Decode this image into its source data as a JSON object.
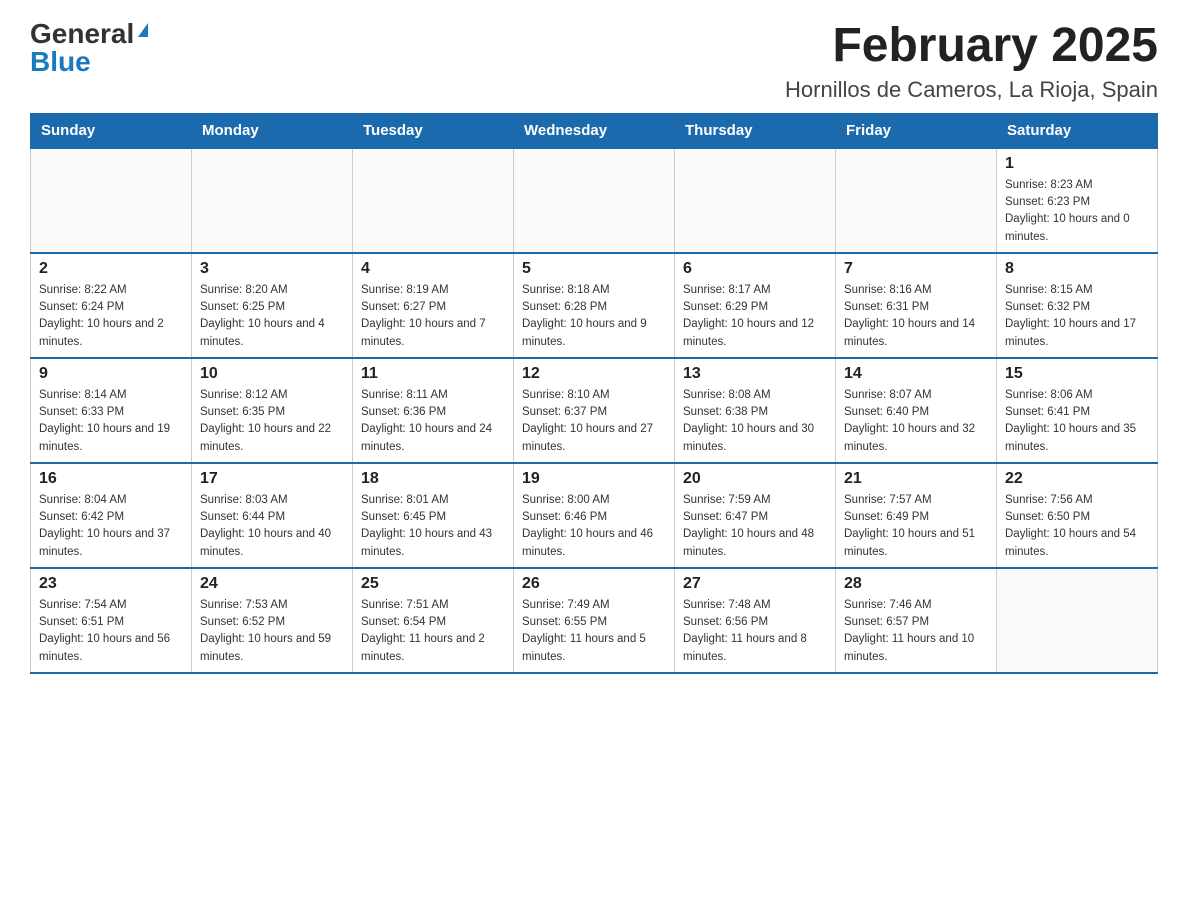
{
  "logo": {
    "general": "General",
    "blue": "Blue"
  },
  "title": {
    "month": "February 2025",
    "location": "Hornillos de Cameros, La Rioja, Spain"
  },
  "weekdays": [
    "Sunday",
    "Monday",
    "Tuesday",
    "Wednesday",
    "Thursday",
    "Friday",
    "Saturday"
  ],
  "weeks": [
    [
      {
        "day": "",
        "info": ""
      },
      {
        "day": "",
        "info": ""
      },
      {
        "day": "",
        "info": ""
      },
      {
        "day": "",
        "info": ""
      },
      {
        "day": "",
        "info": ""
      },
      {
        "day": "",
        "info": ""
      },
      {
        "day": "1",
        "info": "Sunrise: 8:23 AM\nSunset: 6:23 PM\nDaylight: 10 hours and 0 minutes."
      }
    ],
    [
      {
        "day": "2",
        "info": "Sunrise: 8:22 AM\nSunset: 6:24 PM\nDaylight: 10 hours and 2 minutes."
      },
      {
        "day": "3",
        "info": "Sunrise: 8:20 AM\nSunset: 6:25 PM\nDaylight: 10 hours and 4 minutes."
      },
      {
        "day": "4",
        "info": "Sunrise: 8:19 AM\nSunset: 6:27 PM\nDaylight: 10 hours and 7 minutes."
      },
      {
        "day": "5",
        "info": "Sunrise: 8:18 AM\nSunset: 6:28 PM\nDaylight: 10 hours and 9 minutes."
      },
      {
        "day": "6",
        "info": "Sunrise: 8:17 AM\nSunset: 6:29 PM\nDaylight: 10 hours and 12 minutes."
      },
      {
        "day": "7",
        "info": "Sunrise: 8:16 AM\nSunset: 6:31 PM\nDaylight: 10 hours and 14 minutes."
      },
      {
        "day": "8",
        "info": "Sunrise: 8:15 AM\nSunset: 6:32 PM\nDaylight: 10 hours and 17 minutes."
      }
    ],
    [
      {
        "day": "9",
        "info": "Sunrise: 8:14 AM\nSunset: 6:33 PM\nDaylight: 10 hours and 19 minutes."
      },
      {
        "day": "10",
        "info": "Sunrise: 8:12 AM\nSunset: 6:35 PM\nDaylight: 10 hours and 22 minutes."
      },
      {
        "day": "11",
        "info": "Sunrise: 8:11 AM\nSunset: 6:36 PM\nDaylight: 10 hours and 24 minutes."
      },
      {
        "day": "12",
        "info": "Sunrise: 8:10 AM\nSunset: 6:37 PM\nDaylight: 10 hours and 27 minutes."
      },
      {
        "day": "13",
        "info": "Sunrise: 8:08 AM\nSunset: 6:38 PM\nDaylight: 10 hours and 30 minutes."
      },
      {
        "day": "14",
        "info": "Sunrise: 8:07 AM\nSunset: 6:40 PM\nDaylight: 10 hours and 32 minutes."
      },
      {
        "day": "15",
        "info": "Sunrise: 8:06 AM\nSunset: 6:41 PM\nDaylight: 10 hours and 35 minutes."
      }
    ],
    [
      {
        "day": "16",
        "info": "Sunrise: 8:04 AM\nSunset: 6:42 PM\nDaylight: 10 hours and 37 minutes."
      },
      {
        "day": "17",
        "info": "Sunrise: 8:03 AM\nSunset: 6:44 PM\nDaylight: 10 hours and 40 minutes."
      },
      {
        "day": "18",
        "info": "Sunrise: 8:01 AM\nSunset: 6:45 PM\nDaylight: 10 hours and 43 minutes."
      },
      {
        "day": "19",
        "info": "Sunrise: 8:00 AM\nSunset: 6:46 PM\nDaylight: 10 hours and 46 minutes."
      },
      {
        "day": "20",
        "info": "Sunrise: 7:59 AM\nSunset: 6:47 PM\nDaylight: 10 hours and 48 minutes."
      },
      {
        "day": "21",
        "info": "Sunrise: 7:57 AM\nSunset: 6:49 PM\nDaylight: 10 hours and 51 minutes."
      },
      {
        "day": "22",
        "info": "Sunrise: 7:56 AM\nSunset: 6:50 PM\nDaylight: 10 hours and 54 minutes."
      }
    ],
    [
      {
        "day": "23",
        "info": "Sunrise: 7:54 AM\nSunset: 6:51 PM\nDaylight: 10 hours and 56 minutes."
      },
      {
        "day": "24",
        "info": "Sunrise: 7:53 AM\nSunset: 6:52 PM\nDaylight: 10 hours and 59 minutes."
      },
      {
        "day": "25",
        "info": "Sunrise: 7:51 AM\nSunset: 6:54 PM\nDaylight: 11 hours and 2 minutes."
      },
      {
        "day": "26",
        "info": "Sunrise: 7:49 AM\nSunset: 6:55 PM\nDaylight: 11 hours and 5 minutes."
      },
      {
        "day": "27",
        "info": "Sunrise: 7:48 AM\nSunset: 6:56 PM\nDaylight: 11 hours and 8 minutes."
      },
      {
        "day": "28",
        "info": "Sunrise: 7:46 AM\nSunset: 6:57 PM\nDaylight: 11 hours and 10 minutes."
      },
      {
        "day": "",
        "info": ""
      }
    ]
  ]
}
